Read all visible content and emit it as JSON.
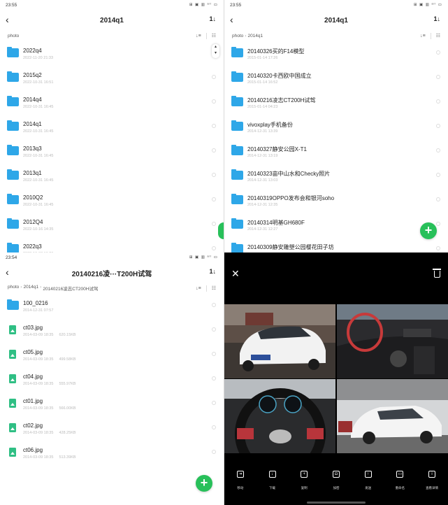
{
  "status": {
    "time_top": "23:55",
    "time_bottom": "23:54",
    "indicators": "⊞ ▣ ▥ ᵃˡˡ ▭"
  },
  "panel_tl": {
    "title": "2014q1",
    "sort_icon": "1↓",
    "breadcrumbs": [
      "photo"
    ],
    "items": [
      {
        "name": "2022q4",
        "date": "2022-11-20 21:33"
      },
      {
        "name": "2015q2",
        "date": "2022-10-31 16:51"
      },
      {
        "name": "2014q4",
        "date": "2022-10-31 16:45"
      },
      {
        "name": "2014q1",
        "date": "2022-10-31 16:45"
      },
      {
        "name": "2013q3",
        "date": "2022-10-31 16:45"
      },
      {
        "name": "2013q1",
        "date": "2022-10-31 16:45"
      },
      {
        "name": "2010Q2",
        "date": "2022-10-31 16:45"
      },
      {
        "name": "2012Q4",
        "date": "2022-10-16 14:35"
      },
      {
        "name": "2022q3",
        "date": "2022-10-03 19:29"
      }
    ]
  },
  "panel_tr": {
    "title": "2014q1",
    "sort_icon": "1↓",
    "breadcrumbs": [
      "photo",
      "2014q1"
    ],
    "items": [
      {
        "name": "20140326买的F14模型",
        "date": "2015-01-14 17:26"
      },
      {
        "name": "20140320卡西欧中国成立",
        "date": "2015-01-14 16:52"
      },
      {
        "name": "20140216凌志CT200H试驾",
        "date": "2015-01-14 04:23"
      },
      {
        "name": "vivoxplay手机备份",
        "date": "2014-12-31 13:39"
      },
      {
        "name": "20140327静安公园X-T1",
        "date": "2014-12-31 13:19"
      },
      {
        "name": "20140323亩中山水和Checky照片",
        "date": "2014-12-31 13:03"
      },
      {
        "name": "20140319OPPO发布会和银河soho",
        "date": "2014-12-31 12:35"
      },
      {
        "name": "20140314明基GH680F",
        "date": "2014-12-31 12:27"
      },
      {
        "name": "20140309静安雕塑公园樱花田子坊",
        "date": ""
      }
    ]
  },
  "panel_bl": {
    "title": "20140216凌···T200H试驾",
    "sort_icon": "1↓",
    "breadcrumbs": [
      "photo",
      "2014q1",
      "20140216凌志CT200H试驾"
    ],
    "folder": {
      "name": "100_0216",
      "date": "2014-12-31 07:57"
    },
    "files": [
      {
        "name": "ct03.jpg",
        "date": "2014-03-09 18:35",
        "size": "620.15KB"
      },
      {
        "name": "ct05.jpg",
        "date": "2014-03-09 18:35",
        "size": "499.58KB"
      },
      {
        "name": "ct04.jpg",
        "date": "2014-03-09 18:35",
        "size": "555.97KB"
      },
      {
        "name": "ct01.jpg",
        "date": "2014-03-09 18:35",
        "size": "566.00KB"
      },
      {
        "name": "ct02.jpg",
        "date": "2014-03-09 18:35",
        "size": "428.25KB"
      },
      {
        "name": "ct06.jpg",
        "date": "2014-03-09 18:35",
        "size": "513.39KB"
      }
    ]
  },
  "viewer": {
    "actions": [
      {
        "label": "移动",
        "icon": "move-icon"
      },
      {
        "label": "下载",
        "icon": "download-icon"
      },
      {
        "label": "复制",
        "icon": "copy-icon"
      },
      {
        "label": "加密",
        "icon": "encrypt-icon"
      },
      {
        "label": "发送",
        "icon": "share-icon"
      },
      {
        "label": "重命名",
        "icon": "rename-icon"
      },
      {
        "label": "查看详情",
        "icon": "info-icon"
      }
    ]
  },
  "colors": {
    "accent_green": "#28c05a",
    "folder_blue": "#2ea7e8",
    "image_green": "#2fbf84"
  }
}
